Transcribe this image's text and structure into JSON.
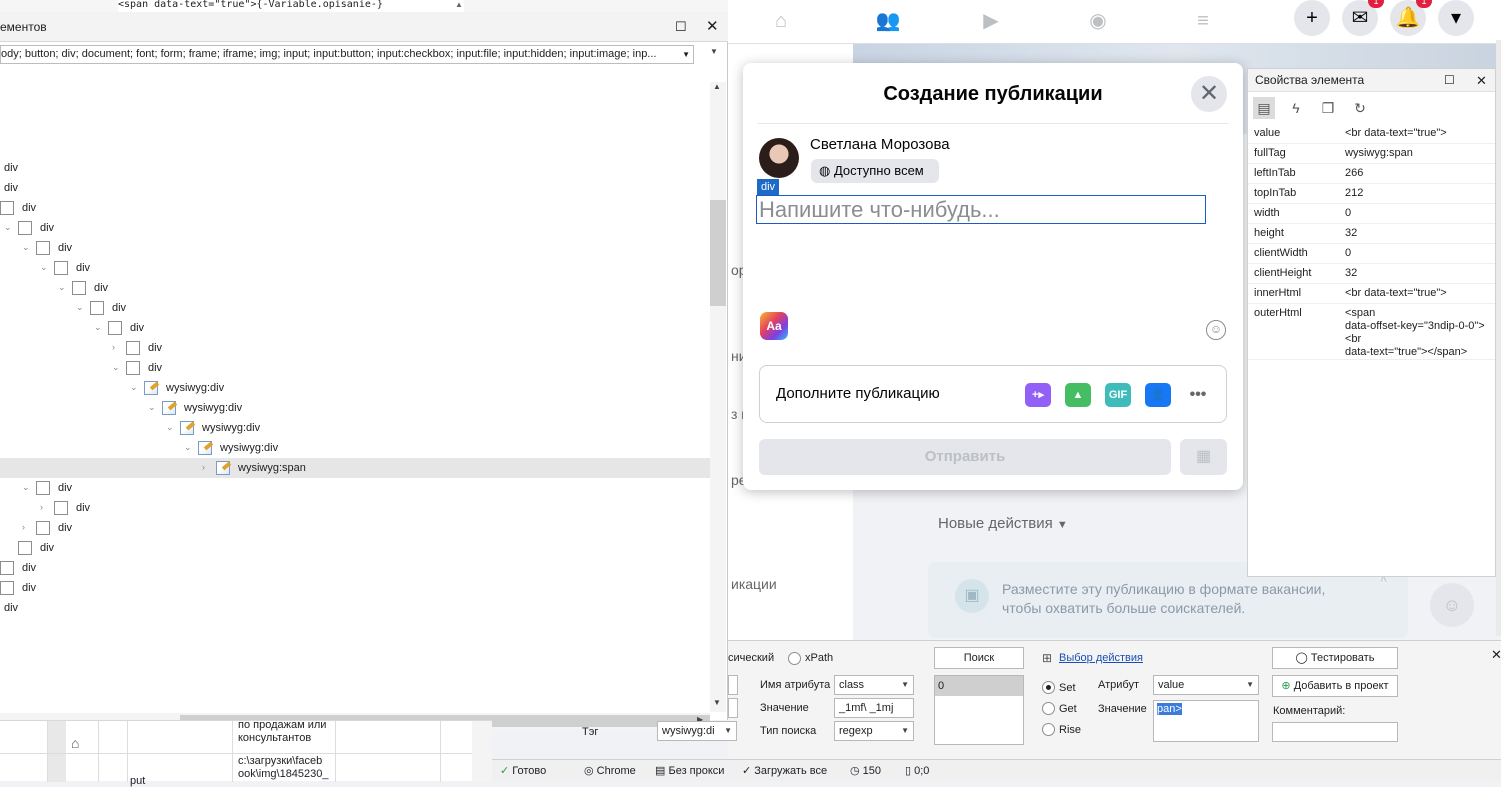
{
  "code_strip": "<span data-text=\"true\">{-Variable.opisanie-}",
  "tree": {
    "title": "ементов",
    "filter": "ody; button; div; document; font; form; frame; iframe; img; input; input:button; input:checkbox; input:file; input:hidden; input:image; inp...",
    "rows": [
      {
        "label": "div"
      },
      {
        "label": "div"
      },
      {
        "label": "div"
      },
      {
        "label": "div"
      },
      {
        "label": "div"
      },
      {
        "label": "div"
      },
      {
        "label": "div"
      },
      {
        "label": "div"
      },
      {
        "label": "div"
      },
      {
        "label": "div"
      },
      {
        "label": "div"
      },
      {
        "label": "wysiwyg:div"
      },
      {
        "label": "wysiwyg:div"
      },
      {
        "label": "wysiwyg:div"
      },
      {
        "label": "wysiwyg:div"
      },
      {
        "label": "wysiwyg:span"
      },
      {
        "label": "div"
      },
      {
        "label": "div"
      },
      {
        "label": "div"
      },
      {
        "label": "div"
      },
      {
        "label": "div"
      },
      {
        "label": "div"
      },
      {
        "label": "div"
      }
    ]
  },
  "facebook": {
    "left_labels": [
      "ор",
      "ни",
      "з и",
      "ре",
      "икации"
    ],
    "new_actions": "Новые действия",
    "job_card_text": "Разместите эту публикацию в формате вакансии, чтобы охватить больше соискателей.",
    "badges": [
      "1",
      "1"
    ]
  },
  "dialog": {
    "title": "Создание публикации",
    "user_name": "Светлана Морозова",
    "audience": "Доступно всем",
    "highlight_tag": "div",
    "placeholder": "Напишите что-нибудь...",
    "aa_label": "Aa",
    "add_to_post": "Дополните публикацию",
    "gif_label": "GIF",
    "send": "Отправить"
  },
  "props": {
    "title": "Свойства элемента",
    "rows": [
      {
        "k": "value",
        "v": "<br data-text=\"true\">"
      },
      {
        "k": "fullTag",
        "v": "wysiwyg:span"
      },
      {
        "k": "leftInTab",
        "v": "266"
      },
      {
        "k": "topInTab",
        "v": "212"
      },
      {
        "k": "width",
        "v": "0"
      },
      {
        "k": "height",
        "v": "32"
      },
      {
        "k": "clientWidth",
        "v": "0"
      },
      {
        "k": "clientHeight",
        "v": "32"
      },
      {
        "k": "innerHtml",
        "v": "<br data-text=\"true\">"
      }
    ],
    "outer_key": "outerHtml",
    "outer_lines": [
      "<span",
      "data-offset-key=\"3ndip-0-0\">",
      "<br",
      "data-text=\"true\"></span>"
    ]
  },
  "bottom": {
    "mode_partial": "сический",
    "mode_xpath": "xPath",
    "search_btn": "Поиск",
    "select_action": "Выбор действия",
    "test_btn": "Тестировать",
    "add_project_btn": "Добавить в проект",
    "attr_name_label": "Имя атрибута",
    "attr_name_value": "class",
    "value_label": "Значение",
    "value_value": "_1mf\\ _1mj",
    "search_type_label": "Тип поиска",
    "search_type_value": "regexp",
    "tag_label": "Тэг",
    "tag_value": "wysiwyg:di",
    "result_value": "0",
    "set": "Set",
    "get": "Get",
    "rise": "Rise",
    "attribute_label": "Атрибут",
    "attribute_value": "value",
    "value2_label": "Значение",
    "value2_value": "pan>",
    "comment_label": "Комментарий:"
  },
  "grid": {
    "cell1": "по продажам или консультантов",
    "cell2": "c:\\загрузки\\faceb ook\\img\\1845230_",
    "cell3": "put"
  },
  "status": {
    "ready": "Готово",
    "browser": "Chrome",
    "proxy": "Без прокси",
    "load_all": "Загружать все",
    "timer": "150",
    "coords": "0;0"
  }
}
